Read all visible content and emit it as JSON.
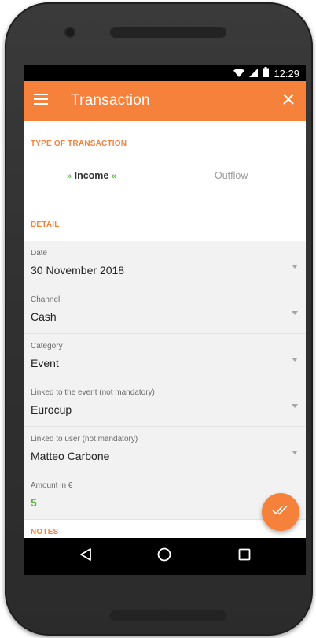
{
  "status_bar": {
    "time": "12:29",
    "wifi_icon": "wifi-icon",
    "signal_icon": "signal-icon",
    "battery_icon": "battery-icon"
  },
  "app_bar": {
    "title": "Transaction",
    "menu_icon": "menu-icon",
    "close_icon": "close-icon",
    "color": "#f5813a"
  },
  "type_section": {
    "header": "TYPE OF TRANSACTION",
    "options": [
      {
        "label": "Income",
        "selected": true
      },
      {
        "label": "Outflow",
        "selected": false
      }
    ],
    "selector_left": "»",
    "selector_right": "«"
  },
  "detail_section": {
    "header": "DETAIL",
    "fields": [
      {
        "label": "Date",
        "value": "30 November 2018",
        "dropdown": true
      },
      {
        "label": "Channel",
        "value": "Cash",
        "dropdown": true
      },
      {
        "label": "Category",
        "value": "Event",
        "dropdown": true
      },
      {
        "label": "Linked to the event (not mandatory)",
        "value": "Eurocup",
        "dropdown": true
      },
      {
        "label": "Linked to user (not mandatory)",
        "value": "Matteo Carbone",
        "dropdown": true
      },
      {
        "label": "Amount in €",
        "value": "5",
        "dropdown": false
      }
    ]
  },
  "notes_section": {
    "header": "NOTES"
  },
  "fab": {
    "icon": "double-check-icon"
  },
  "nav_bar": {
    "back_icon": "back-triangle-icon",
    "home_icon": "home-circle-icon",
    "recents_icon": "recents-square-icon"
  }
}
